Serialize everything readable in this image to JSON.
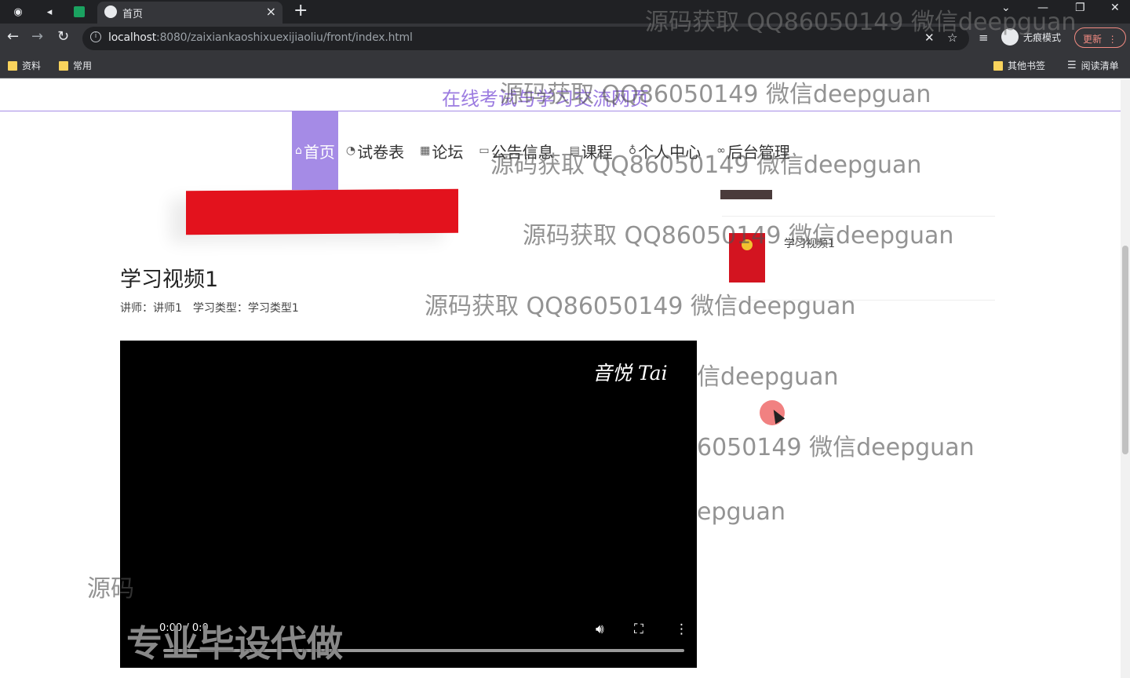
{
  "browser": {
    "tab_title": "首页",
    "new_tab_symbol": "+",
    "close_symbol": "×",
    "url_host": "localhost",
    "url_rest": ":8080/zaixiankaoshixuexijiaoliu/front/index.html",
    "incognito_label": "无痕模式",
    "update_label": "更新",
    "bookmarks": [
      "资料",
      "常用"
    ],
    "bookmarks_right": [
      "其他书签",
      "阅读清单"
    ]
  },
  "site": {
    "title": "在线考试与学习交流网页",
    "nav": [
      {
        "label": "首页",
        "icon": "home-icon",
        "active": true
      },
      {
        "label": "试卷表",
        "icon": "gauge-icon",
        "active": false
      },
      {
        "label": "论坛",
        "icon": "grid-icon",
        "active": false
      },
      {
        "label": "公告信息",
        "icon": "message-icon",
        "active": false
      },
      {
        "label": "课程",
        "icon": "calendar-icon",
        "active": false
      },
      {
        "label": "个人中心",
        "icon": "user-icon",
        "active": false
      },
      {
        "label": "后台管理",
        "icon": "link-icon",
        "active": false
      }
    ]
  },
  "content": {
    "video_title": "学习视频1",
    "teacher_label": "讲师：",
    "teacher_value": "讲师1",
    "type_label": "学习类型：",
    "type_value": "学习类型1",
    "side_item_label": "学习视频1",
    "video_logo": "音悦 Tai",
    "video_time": "0:00 / 0:0",
    "overlay_text": "专业毕设代做",
    "progress": 0
  },
  "watermark": {
    "text": "源码获取 QQ86050149 微信deepguan",
    "partial_1": "信deepguan",
    "partial_2": "6050149 微信deepguan",
    "partial_3": "epguan",
    "partial_4": "源码"
  }
}
